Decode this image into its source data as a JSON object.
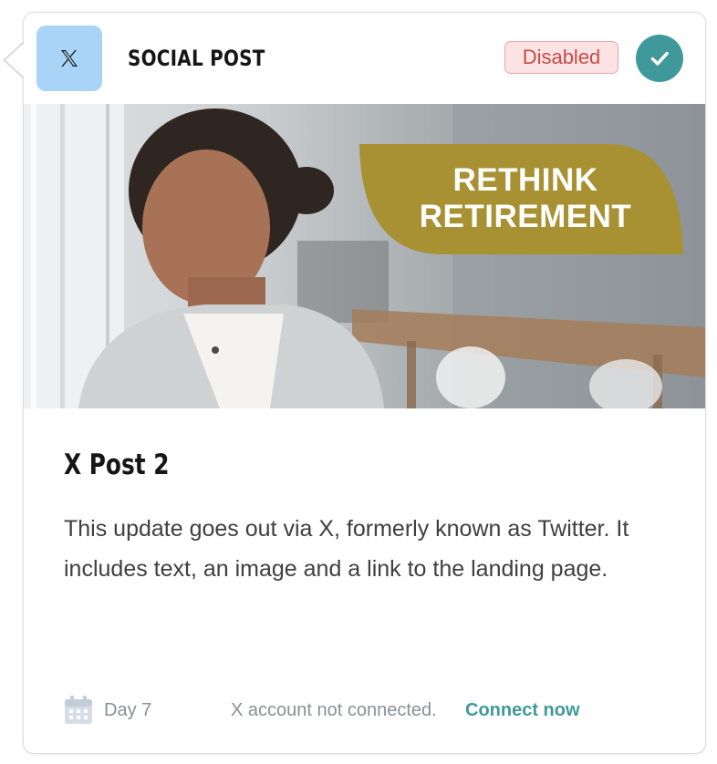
{
  "card": {
    "type_label": "SOCIAL POST",
    "status_badge": "Disabled",
    "platform_icon": "x-logo-icon",
    "status_icon": "check-icon"
  },
  "image": {
    "banner_line1": "RETHINK",
    "banner_line2": "RETIREMENT"
  },
  "post": {
    "title": "X Post 2",
    "description": "This update goes out via X, formerly known as Twitter. It includes text, an image and a link to the landing page."
  },
  "footer": {
    "day": "Day 7",
    "connection_status": "X account not connected.",
    "connect_link": "Connect now",
    "day_icon": "calendar-icon"
  },
  "colors": {
    "accent_teal": "#3f999b",
    "platform_tile": "#a9d4f7",
    "badge_bg": "#fce3e3",
    "badge_text": "#c94a4a",
    "banner_gold": "#a89133"
  }
}
